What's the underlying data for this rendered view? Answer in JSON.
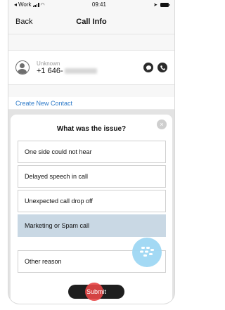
{
  "status_bar": {
    "carrier": "Work",
    "time": "09:41"
  },
  "navbar": {
    "back_label": "Back",
    "title": "Call Info"
  },
  "contact": {
    "name": "Unknown",
    "number": "+1 646-"
  },
  "create_contact_label": "Create New Contact",
  "sheet": {
    "title": "What was the issue?",
    "close_label": "×",
    "options": [
      {
        "label": "One side could not hear",
        "selected": false
      },
      {
        "label": "Delayed speech in call",
        "selected": false
      },
      {
        "label": "Unexpected call drop off",
        "selected": false
      },
      {
        "label": "Marketing or Spam call",
        "selected": true
      }
    ],
    "other_placeholder": "Other reason",
    "submit_label": "Submit"
  },
  "colors": {
    "link": "#2a78c8",
    "selected_option": "#c9d8e4",
    "submit_bg": "#1f1f1f",
    "blackberry_badge": "#9fd8f4",
    "tap_indicator": "#e84646"
  }
}
